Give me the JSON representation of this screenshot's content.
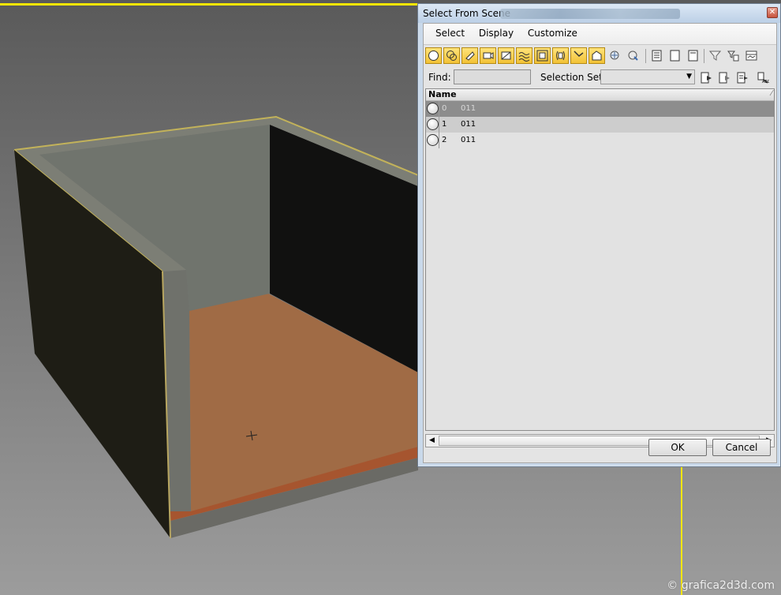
{
  "dialog": {
    "title": "Select From Scene",
    "close_glyph": "✕",
    "menu": [
      "Select",
      "Display",
      "Customize"
    ],
    "find_label": "Find:",
    "find_value": "",
    "selection_set_label": "Selection Set:",
    "selection_set_value": "",
    "column_name": "Name",
    "rows": [
      {
        "index": "0",
        "name": "011",
        "selected": true
      },
      {
        "index": "1",
        "name": "011",
        "selected": false
      },
      {
        "index": "2",
        "name": "011",
        "selected": false
      }
    ],
    "ok_label": "OK",
    "cancel_label": "Cancel"
  },
  "viewport": {
    "watermark": "© grafica2d3d.com"
  },
  "colors": {
    "toolbar_active": "#f2c236",
    "floor": "#a06b45",
    "wall_dark": "#1e1d15",
    "wall_interior": "#70746d",
    "selection_bracket": "#f7e600"
  }
}
